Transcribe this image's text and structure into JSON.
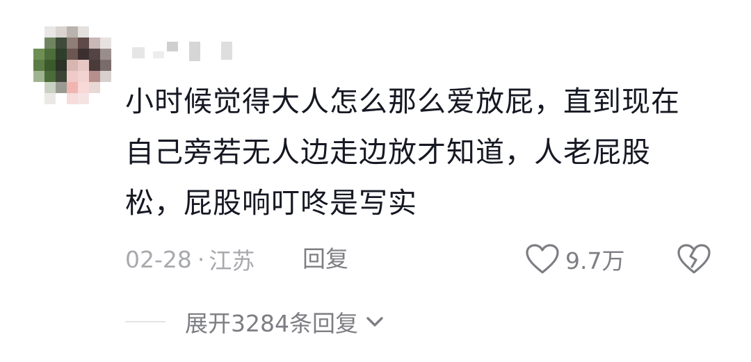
{
  "comment": {
    "text": "小时候觉得大人怎么那么爱放屁，直到现在自己旁若无人边走边放才知道，人老屁股松，屁股响叮咚是写实",
    "date": "02-28",
    "separator": "·",
    "location": "江苏",
    "reply_label": "回复",
    "like_count": "9.7万",
    "expand_label": "展开3284条回复"
  },
  "icons": {
    "like": "heart-outline-icon",
    "dislike": "broken-heart-icon",
    "expand": "chevron-down-icon"
  },
  "colors": {
    "text_primary": "#161823",
    "text_secondary": "#a8a9ad",
    "action_gray": "#7d7e83"
  }
}
